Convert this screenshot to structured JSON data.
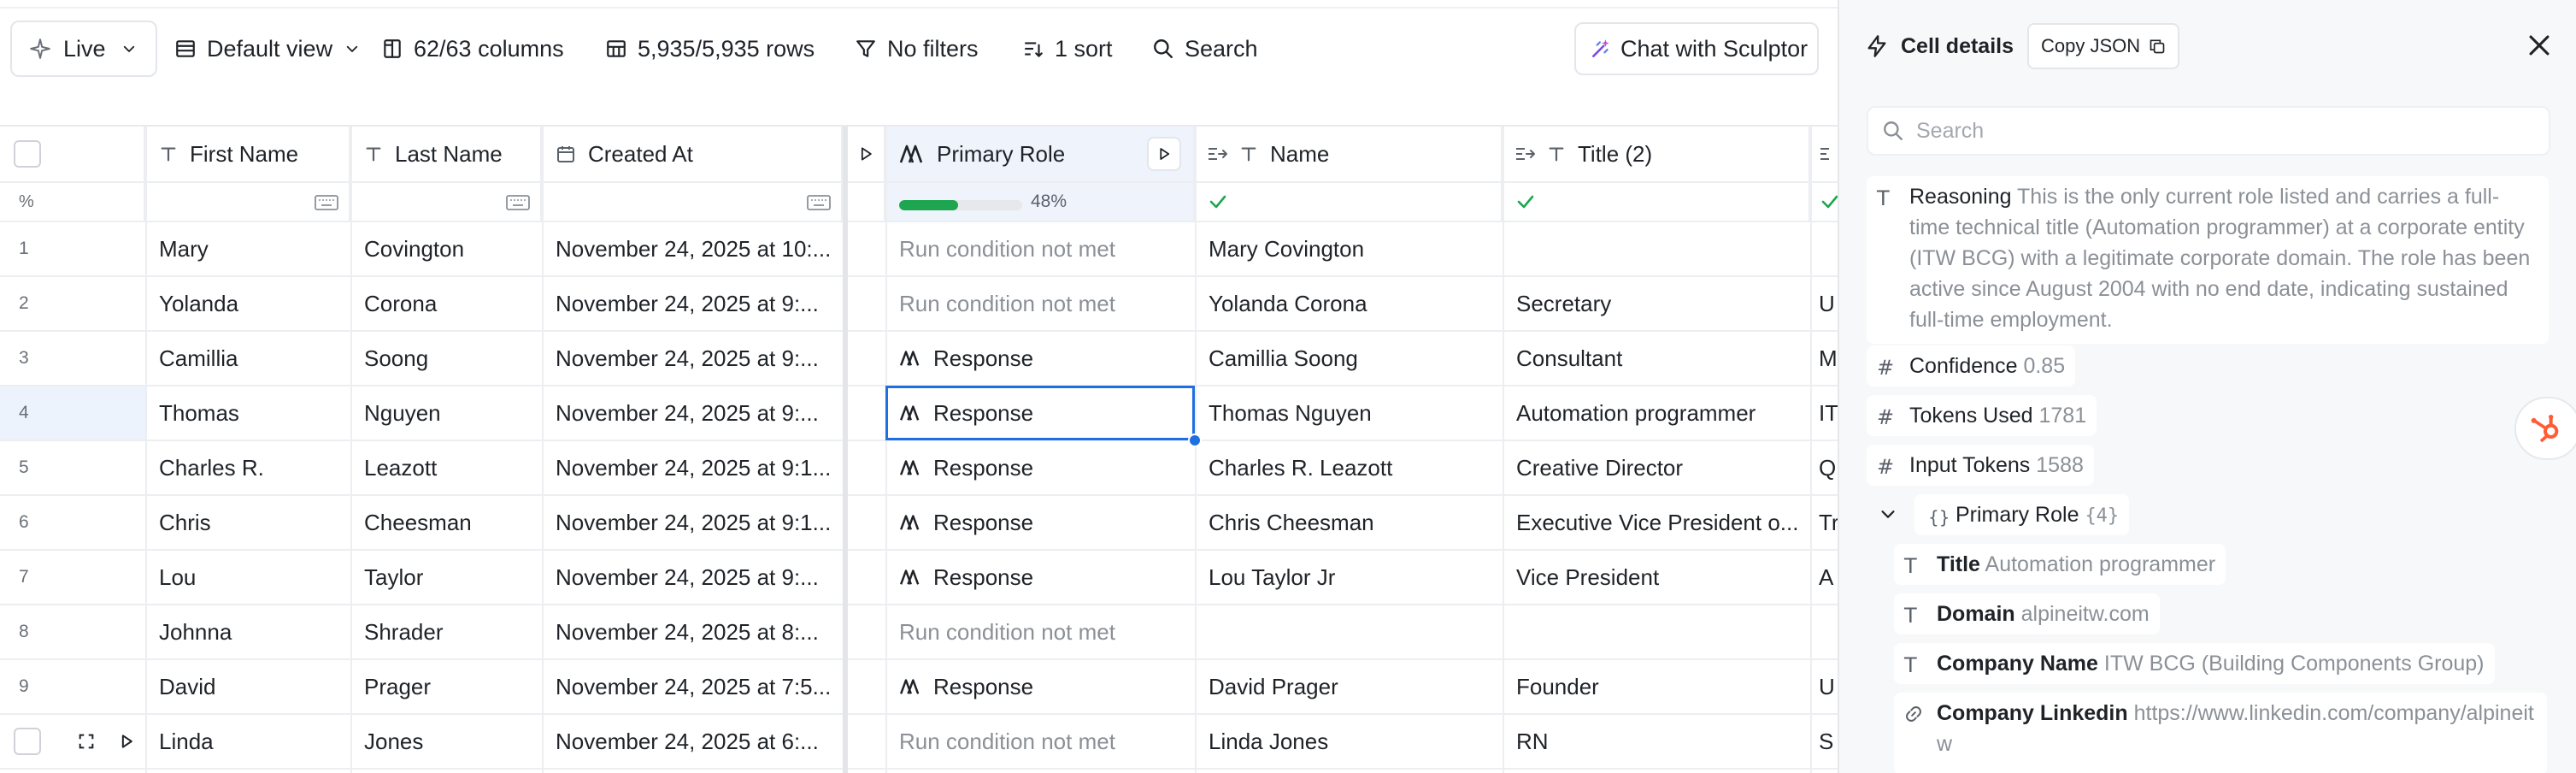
{
  "toolbar": {
    "live_label": "Live",
    "view_label": "Default view",
    "columns_label": "62/63 columns",
    "rows_label": "5,935/5,935 rows",
    "filters_label": "No filters",
    "sort_label": "1 sort",
    "search_label": "Search",
    "sculptor_label": "Chat with Sculptor"
  },
  "table": {
    "row_number_header": "%",
    "columns": [
      {
        "label": "First Name",
        "icon": "text-type-icon"
      },
      {
        "label": "Last Name",
        "icon": "text-type-icon"
      },
      {
        "label": "Created At",
        "icon": "calendar-icon"
      },
      {
        "label": "Primary Role",
        "icon": "ai-agent-icon"
      },
      {
        "label": "Name",
        "icon": "text-type-icon"
      },
      {
        "label": "Title (2)",
        "icon": "text-type-icon"
      }
    ],
    "primary_role_progress": 48,
    "primary_role_progress_label": "48%",
    "rows": [
      {
        "num": "1",
        "first": "Mary",
        "last": "Covington",
        "created": "November 24, 2025 at 10:...",
        "role": "Run condition not met",
        "role_type": "muted",
        "name": "Mary Covington",
        "title": "",
        "extra": ""
      },
      {
        "num": "2",
        "first": "Yolanda",
        "last": "Corona",
        "created": "November 24, 2025 at 9:...",
        "role": "Run condition not met",
        "role_type": "muted",
        "name": "Yolanda Corona",
        "title": "Secretary",
        "extra": "U"
      },
      {
        "num": "3",
        "first": "Camillia",
        "last": "Soong",
        "created": "November 24, 2025 at 9:...",
        "role": "Response",
        "role_type": "response",
        "name": "Camillia Soong",
        "title": "Consultant",
        "extra": "M"
      },
      {
        "num": "4",
        "first": "Thomas",
        "last": "Nguyen",
        "created": "November 24, 2025 at 9:...",
        "role": "Response",
        "role_type": "response",
        "name": "Thomas Nguyen",
        "title": "Automation programmer",
        "extra": "IT"
      },
      {
        "num": "5",
        "first": "Charles R.",
        "last": "Leazott",
        "created": "November 24, 2025 at 9:1...",
        "role": "Response",
        "role_type": "response",
        "name": "Charles R. Leazott",
        "title": "Creative Director",
        "extra": "Q"
      },
      {
        "num": "6",
        "first": "Chris",
        "last": "Cheesman",
        "created": "November 24, 2025 at 9:1...",
        "role": "Response",
        "role_type": "response",
        "name": "Chris Cheesman",
        "title": "Executive Vice President o...",
        "extra": "Tr"
      },
      {
        "num": "7",
        "first": "Lou",
        "last": "Taylor",
        "created": "November 24, 2025 at 9:...",
        "role": "Response",
        "role_type": "response",
        "name": "Lou Taylor Jr",
        "title": "Vice President",
        "extra": "A"
      },
      {
        "num": "8",
        "first": "Johnna",
        "last": "Shrader",
        "created": "November 24, 2025 at 8:...",
        "role": "Run condition not met",
        "role_type": "muted",
        "name": "",
        "title": "",
        "extra": ""
      },
      {
        "num": "9",
        "first": "David",
        "last": "Prager",
        "created": "November 24, 2025 at 7:5...",
        "role": "Response",
        "role_type": "response",
        "name": "David Prager",
        "title": "Founder",
        "extra": "U"
      },
      {
        "num": "",
        "first": "Linda",
        "last": "Jones",
        "created": "November 24, 2025 at 6:...",
        "role": "Run condition not met",
        "role_type": "muted",
        "name": "Linda Jones",
        "title": "RN",
        "extra": "S"
      }
    ]
  },
  "panel": {
    "title": "Cell details",
    "copy_json_label": "Copy JSON",
    "search_placeholder": "Search",
    "reasoning_key": "Reasoning",
    "reasoning_value": "This is the only current role listed and carries a full-time technical title (Automation programmer) at a corporate entity (ITW BCG) with a legitimate corporate domain. The role has been active since August 2004 with no end date, indicating sustained full-time employment.",
    "confidence_key": "Confidence",
    "confidence_value": "0.85",
    "tokens_used_key": "Tokens Used",
    "tokens_used_value": "1781",
    "input_tokens_key": "Input Tokens",
    "input_tokens_value": "1588",
    "primary_role_key": "Primary Role",
    "primary_role_count": "{4}",
    "title_key": "Title",
    "title_value": "Automation programmer",
    "domain_key": "Domain",
    "domain_value": "alpineitw.com",
    "company_key": "Company Name",
    "company_value": "ITW BCG (Building Components Group)",
    "linkedin_key": "Company Linkedin",
    "linkedin_value": "https://www.linkedin.com/company/alpineitw"
  },
  "colors": {
    "accent_blue": "#1f6fe0",
    "progress_green": "#1ea54f",
    "hubspot_orange": "#ff5c35"
  }
}
